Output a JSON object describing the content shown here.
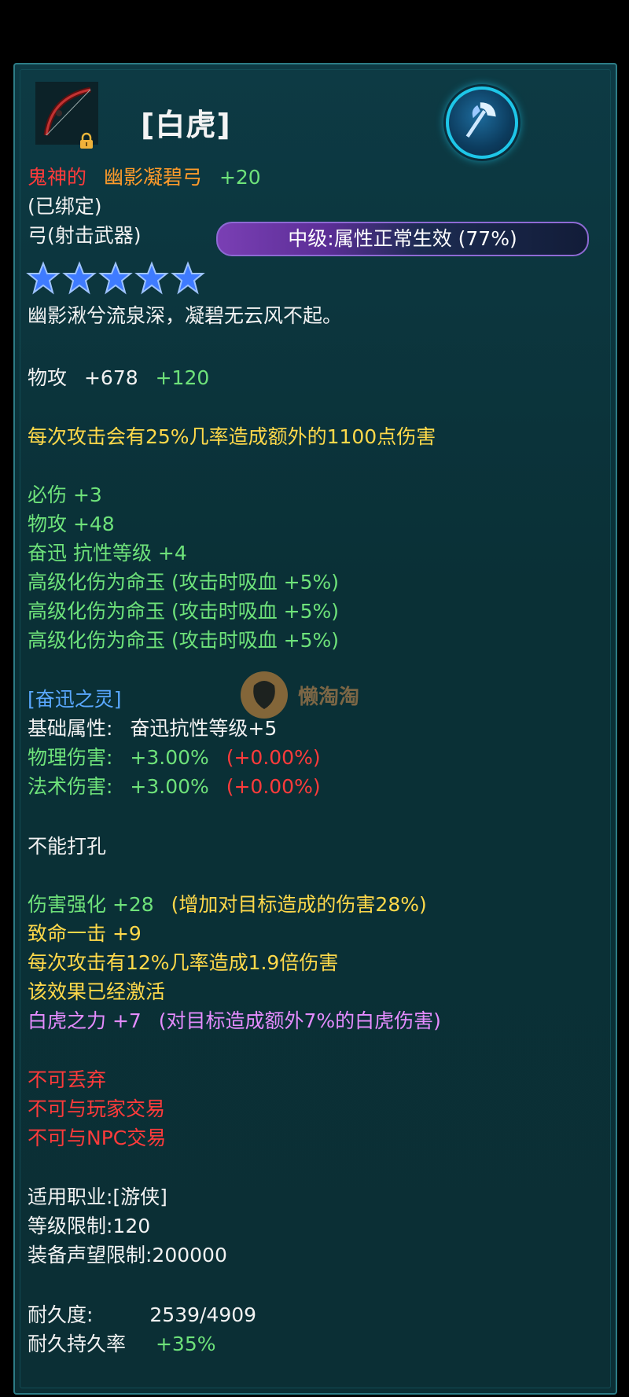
{
  "header": {
    "title": "[白虎]",
    "prefix": "鬼神的",
    "item_name": "幽影凝碧弓",
    "enhance": "+20",
    "bound": "(已绑定)",
    "weapon_type": "弓(射击武器)",
    "quality": "中级:属性正常生效 (77%)",
    "stars": 5,
    "flavor": "幽影湫兮流泉深，凝碧无云风不起。"
  },
  "attack": {
    "label": "物攻",
    "base": "+678",
    "bonus": "+120"
  },
  "effect_proc": "每次攻击会有25%几率造成额外的1100点伤害",
  "bonus_stats": [
    "必伤 +3",
    "物攻 +48",
    "奋迅 抗性等级 +4",
    "高级化伤为命玉 (攻击时吸血 +5%)",
    "高级化伤为命玉 (攻击时吸血 +5%)",
    "高级化伤为命玉 (攻击时吸血 +5%)"
  ],
  "spirit": {
    "title": "[奋迅之灵]",
    "base_label": "基础属性:",
    "base_value": "奋迅抗性等级+5",
    "phys_label": "物理伤害:",
    "phys_value": "+3.00%",
    "phys_extra": "(+0.00%)",
    "magic_label": "法术伤害:",
    "magic_value": "+3.00%",
    "magic_extra": "(+0.00%)"
  },
  "socket": "不能打孔",
  "extra": {
    "dmg_label": "伤害强化 +28",
    "dmg_desc": "(增加对目标造成的伤害28%)",
    "crit": "致命一击 +9",
    "proc2": "每次攻击有12%几率造成1.9倍伤害",
    "active": "该效果已经激活",
    "tiger_label": "白虎之力 +7",
    "tiger_desc": "(对目标造成额外7%的白虎伤害)"
  },
  "restrictions": [
    "不可丢弃",
    "不可与玩家交易",
    "不可与NPC交易"
  ],
  "requirements": {
    "class": "适用职业:[游侠]",
    "level": "等级限制:120",
    "fame": "装备声望限制:200000"
  },
  "durability": {
    "label": "耐久度:",
    "value": "2539/4909",
    "rate_label": "耐久持久率",
    "rate_value": "+35%"
  },
  "watermark": "懒淘淘",
  "colors": {
    "green": "#6ee27a",
    "yellow": "#ffd94a",
    "red": "#ff3b3b",
    "orange": "#ff9b2a",
    "blue": "#5aa8ff",
    "pink": "#e58cff",
    "star": "#3f7bff"
  },
  "icons": [
    "bow-icon",
    "lock-icon",
    "axe-icon",
    "star-icon"
  ]
}
